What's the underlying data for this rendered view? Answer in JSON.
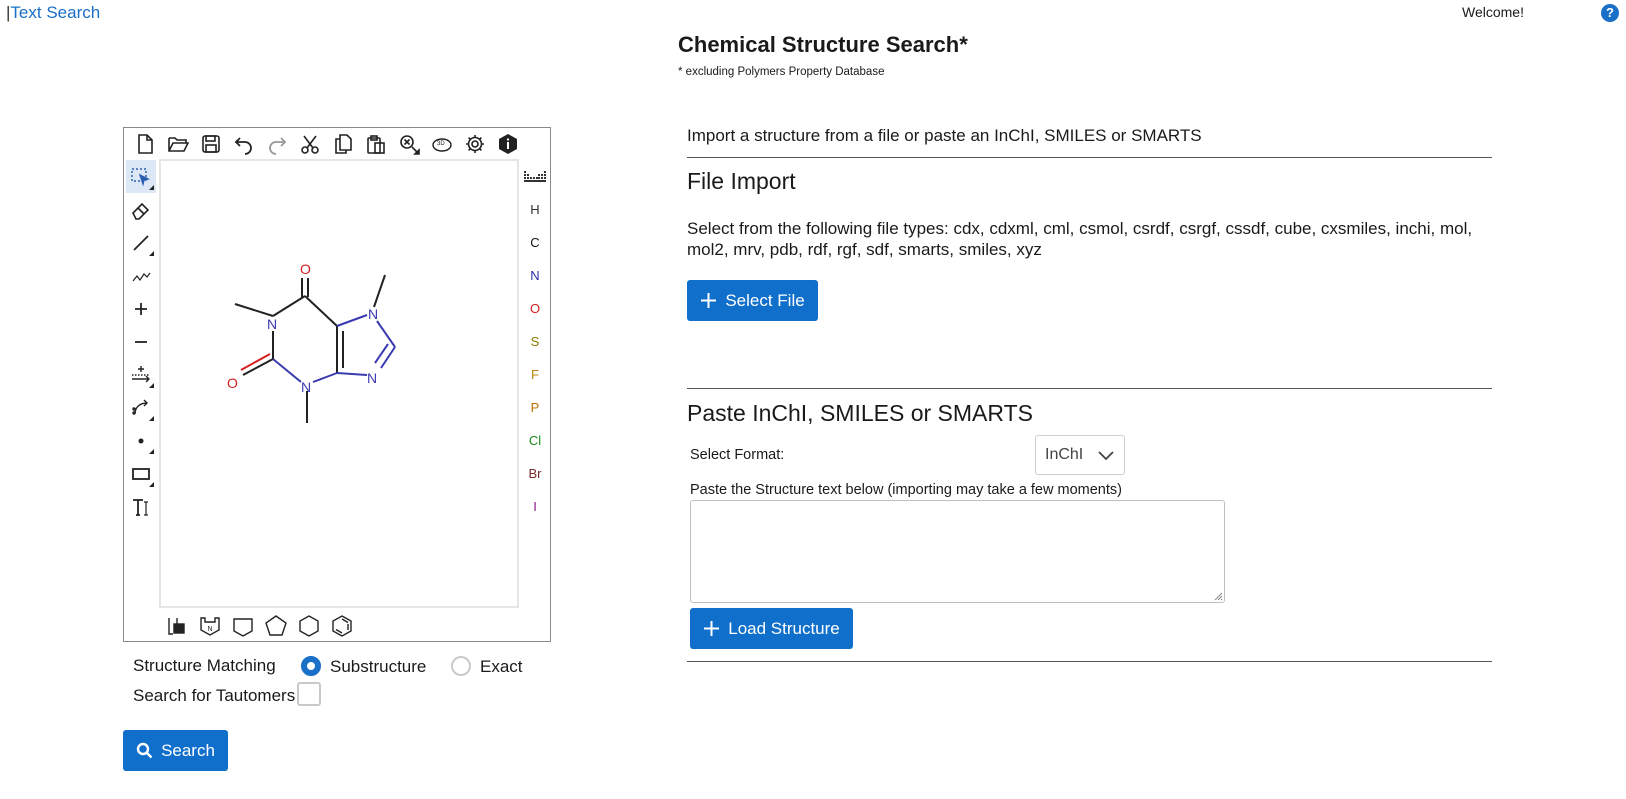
{
  "nav": {
    "separator": "|",
    "text_search": "Text Search"
  },
  "header": {
    "welcome": "Welcome!",
    "help": "?"
  },
  "page": {
    "title": "Chemical Structure Search*",
    "subtitle": "* excluding Polymers Property Database"
  },
  "sketcher": {
    "top_tools": [
      "new-doc-icon",
      "open-folder-icon",
      "save-icon",
      "undo-icon",
      "redo-icon",
      "cut-icon",
      "copy-icon",
      "paste-icon",
      "zoom-icon",
      "3d-icon",
      "settings-icon",
      "info-icon"
    ],
    "left_tools": [
      "select-icon",
      "eraser-icon",
      "bond-icon",
      "chain-icon",
      "charge-plus-icon",
      "charge-minus-icon",
      "reaction-arrow-icon",
      "mechanism-arrow-icon",
      "radical-icon",
      "rectangle-icon",
      "text-icon"
    ],
    "elements": [
      {
        "symbol": "H",
        "color": "#333333"
      },
      {
        "symbol": "C",
        "color": "#111111"
      },
      {
        "symbol": "N",
        "color": "#2b2bb0"
      },
      {
        "symbol": "O",
        "color": "#d42020"
      },
      {
        "symbol": "S",
        "color": "#8a7a00"
      },
      {
        "symbol": "F",
        "color": "#b8860b"
      },
      {
        "symbol": "P",
        "color": "#c07000"
      },
      {
        "symbol": "Cl",
        "color": "#1a8a1a"
      },
      {
        "symbol": "Br",
        "color": "#7a2a2a"
      },
      {
        "symbol": "I",
        "color": "#8a1a8a"
      }
    ],
    "bottom_tools": [
      "template-icon",
      "ring-n-icon",
      "cyclobutane-icon",
      "cyclopentane-icon",
      "cyclohexane-icon",
      "benzene-icon"
    ],
    "molecule_labels": {
      "n1": "N",
      "n3": "N",
      "n7": "N",
      "n9": "N",
      "o2": "O",
      "o6": "O"
    }
  },
  "options": {
    "structure_matching": "Structure Matching",
    "substructure": "Substructure",
    "exact": "Exact",
    "selected": "substructure",
    "tautomers": "Search for Tautomers",
    "tautomers_checked": false
  },
  "search_button": "Search",
  "import": {
    "intro": "Import a structure from a file or paste an InChI, SMILES or SMARTS",
    "file_heading": "File Import",
    "file_types": "Select from the following file types: cdx, cdxml, cml, csmol, csrdf, csrgf, cssdf, cube, cxsmiles, inchi, mol, mol2, mrv, pdb, rdf, rgf, sdf, smarts, smiles, xyz",
    "select_file": "Select File",
    "paste_heading": "Paste InChI, SMILES or SMARTS",
    "select_format_label": "Select Format:",
    "format_value": "InChI",
    "paste_label": "Paste the Structure text below (importing may take a few moments)",
    "paste_value": "",
    "load_button": "Load Structure"
  },
  "colors": {
    "accent": "#0f6fcb",
    "link": "#1a6fc7",
    "nitrogen": "#3a3ab0",
    "oxygen": "#d42020"
  }
}
